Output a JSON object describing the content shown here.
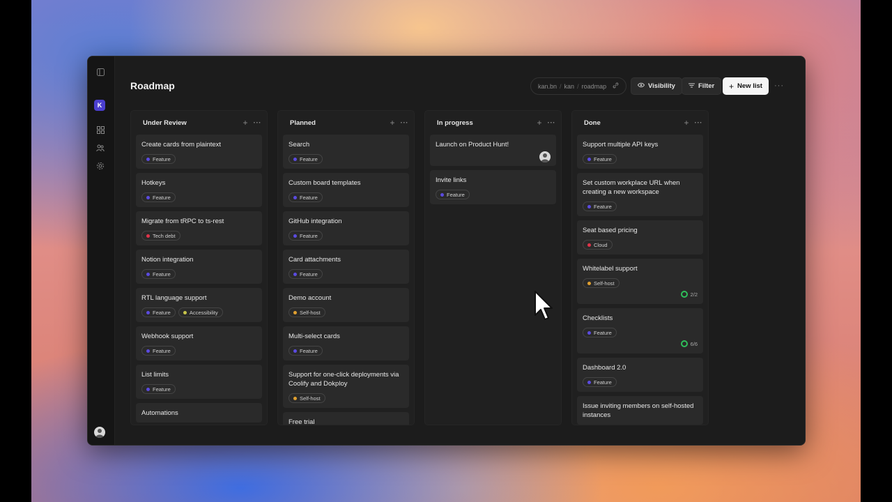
{
  "header": {
    "title": "Roadmap",
    "breadcrumb": [
      "kan.bn",
      "kan",
      "roadmap"
    ],
    "visibility_label": "Visibility",
    "filter_label": "Filter",
    "new_list_label": "New list"
  },
  "sidebar": {
    "workspace_initial": "K"
  },
  "colors": {
    "Feature": "#5b4be0",
    "Tech debt": "#e0344a",
    "Accessibility": "#c7c44a",
    "Self-host": "#e0a030",
    "Cloud": "#e0344a",
    "progress": "#2fbf5a"
  },
  "columns": [
    {
      "name": "Under Review",
      "cards": [
        {
          "title": "Create cards from plaintext",
          "tags": [
            "Feature"
          ]
        },
        {
          "title": "Hotkeys",
          "tags": [
            "Feature"
          ]
        },
        {
          "title": "Migrate from tRPC to ts-rest",
          "tags": [
            "Tech debt"
          ]
        },
        {
          "title": "Notion integration",
          "tags": [
            "Feature"
          ]
        },
        {
          "title": "RTL language support",
          "tags": [
            "Feature",
            "Accessibility"
          ]
        },
        {
          "title": "Webhook support",
          "tags": [
            "Feature"
          ]
        },
        {
          "title": "List limits",
          "tags": [
            "Feature"
          ]
        },
        {
          "title": "Automations",
          "tags": []
        }
      ]
    },
    {
      "name": "Planned",
      "cards": [
        {
          "title": "Search",
          "tags": [
            "Feature"
          ]
        },
        {
          "title": "Custom board templates",
          "tags": [
            "Feature"
          ]
        },
        {
          "title": "GitHub integration",
          "tags": [
            "Feature"
          ]
        },
        {
          "title": "Card attachments",
          "tags": [
            "Feature"
          ]
        },
        {
          "title": "Demo account",
          "tags": [
            "Self-host"
          ]
        },
        {
          "title": "Multi-select cards",
          "tags": [
            "Feature"
          ]
        },
        {
          "title": "Support for one-click deployments via Coolify and Dokploy",
          "tags": [
            "Self-host"
          ]
        },
        {
          "title": "Free trial",
          "tags": []
        }
      ]
    },
    {
      "name": "In progress",
      "cards": [
        {
          "title": "Launch on Product Hunt!",
          "tags": [],
          "avatar": true
        },
        {
          "title": "Invite links",
          "tags": [
            "Feature"
          ]
        }
      ]
    },
    {
      "name": "Done",
      "cards": [
        {
          "title": "Support multiple API keys",
          "tags": [
            "Feature"
          ]
        },
        {
          "title": "Set custom workplace URL when creating a new workspace",
          "tags": [
            "Feature"
          ]
        },
        {
          "title": "Seat based pricing",
          "tags": [
            "Cloud"
          ]
        },
        {
          "title": "Whitelabel support",
          "tags": [
            "Self-host"
          ],
          "progress": "2/2"
        },
        {
          "title": "Checklists",
          "tags": [
            "Feature"
          ],
          "progress": "6/6"
        },
        {
          "title": "Dashboard 2.0",
          "tags": [
            "Feature"
          ]
        },
        {
          "title": "Issue inviting members on self-hosted instances",
          "tags": []
        }
      ]
    }
  ]
}
